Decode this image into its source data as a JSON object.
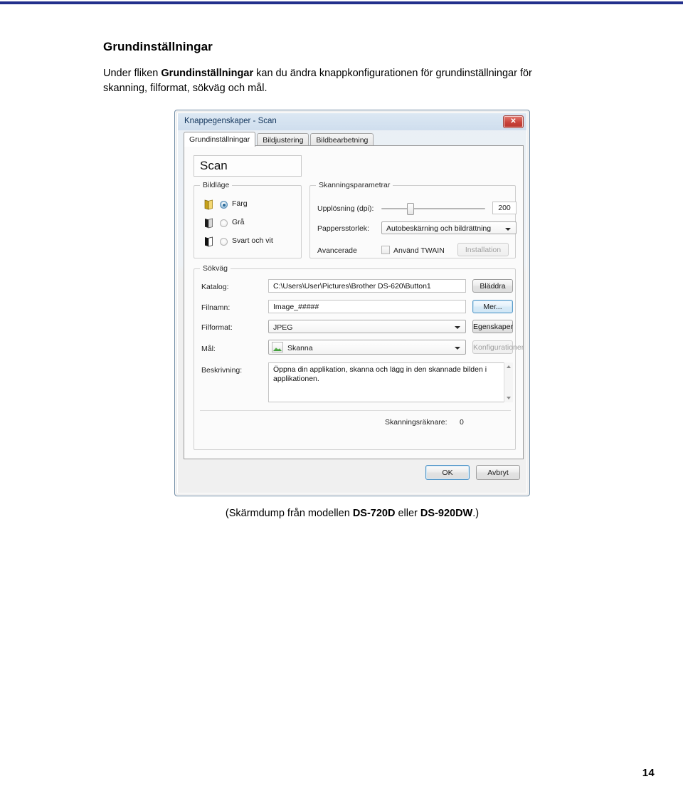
{
  "page": {
    "number": "14",
    "heading": "Grundinställningar",
    "paragraph_part1": "Under fliken ",
    "paragraph_bold1": "Grundinställningar",
    "paragraph_part2": " kan du ändra knappkonfigurationen för grundinställningar för skanning, filformat, sökväg och mål.",
    "caption_part1": "(Skärmdump från modellen ",
    "caption_bold1": "DS-720D",
    "caption_part2": " eller ",
    "caption_bold2": "DS-920DW",
    "caption_part3": ".)",
    "rule_color": "#23308c"
  },
  "dialog": {
    "title": "Knappegenskaper - Scan",
    "close_label": "✕",
    "tabs": [
      {
        "label": "Grundinställningar",
        "active": true
      },
      {
        "label": "Bildjustering",
        "active": false
      },
      {
        "label": "Bildbearbetning",
        "active": false
      }
    ],
    "scan_name": "Scan",
    "image_mode": {
      "group_label": "Bildläge",
      "options": [
        {
          "label": "Färg",
          "selected": true,
          "icon": "color-book-icon"
        },
        {
          "label": "Grå",
          "selected": false,
          "icon": "gray-book-icon"
        },
        {
          "label": "Svart och vit",
          "selected": false,
          "icon": "bw-book-icon"
        }
      ]
    },
    "scan_params": {
      "group_label": "Skanningsparametrar",
      "resolution_label": "Upplösning (dpi):",
      "resolution_value": "200",
      "slider_percent": 25,
      "paper_size_label": "Pappersstorlek:",
      "paper_size_value": "Autobeskärning och bildrättning",
      "advanced_label": "Avancerade",
      "twain_label": "Använd TWAIN",
      "twain_checked": false,
      "install_button": "Installation",
      "install_disabled": true
    },
    "path": {
      "group_label": "Sökväg",
      "folder_label": "Katalog:",
      "folder_value": "C:\\Users\\User\\Pictures\\Brother DS-620\\Button1",
      "browse_button": "Bläddra",
      "filename_label": "Filnamn:",
      "filename_value": "Image_#####",
      "more_button": "Mer...",
      "fileformat_label": "Filformat:",
      "fileformat_value": "JPEG",
      "properties_button": "Egenskaper",
      "destination_label": "Mål:",
      "destination_value": "Skanna",
      "destination_icon": "picture-icon",
      "config_button": "Konfigurationer",
      "config_disabled": true,
      "description_label": "Beskrivning:",
      "description_value": "Öppna din applikation, skanna och lägg in den skannade bilden i applikationen.",
      "counter_label": "Skanningsräknare:",
      "counter_value": "0"
    },
    "footer": {
      "ok_button": "OK",
      "cancel_button": "Avbryt"
    }
  }
}
